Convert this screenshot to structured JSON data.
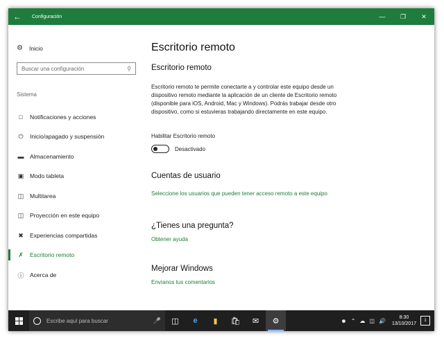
{
  "window": {
    "title": "Configuración",
    "back_icon": "arrow-left-icon",
    "accent": "#1e7d3c"
  },
  "sidebar": {
    "home_label": "Inicio",
    "search_placeholder": "Buscar una configuración",
    "section_label": "Sistema",
    "items": [
      {
        "label": "Notificaciones y acciones",
        "icon": "notification-icon"
      },
      {
        "label": "Inicio/apagado y suspensión",
        "icon": "power-icon"
      },
      {
        "label": "Almacenamiento",
        "icon": "storage-icon"
      },
      {
        "label": "Modo tableta",
        "icon": "tablet-icon"
      },
      {
        "label": "Multitarea",
        "icon": "multitask-icon"
      },
      {
        "label": "Proyección en este equipo",
        "icon": "project-icon"
      },
      {
        "label": "Experiencias compartidas",
        "icon": "shared-icon"
      },
      {
        "label": "Escritorio remoto",
        "icon": "remote-icon",
        "active": true
      },
      {
        "label": "Acerca de",
        "icon": "info-icon"
      }
    ]
  },
  "main": {
    "page_title": "Escritorio remoto",
    "section_title": "Escritorio remoto",
    "description": "Escritorio remoto te permite conectarte a y controlar este equipo desde un dispositivo remoto mediante la aplicación de un cliente de Escritorio remoto (disponible para iOS, Android, Mac y Windows). Podrás trabajar desde otro dispositivo, como si estuvieras trabajando directamente en este equipo.",
    "toggle_label": "Habilitar Escritorio remoto",
    "toggle_state": "Desactivado",
    "accounts_title": "Cuentas de usuario",
    "accounts_link": "Seleccione los usuarios que pueden tener acceso remoto a este equipo",
    "question_title": "¿Tienes una pregunta?",
    "help_link": "Obtener ayuda",
    "improve_title": "Mejorar Windows",
    "feedback_link": "Envíanos tus comentarios"
  },
  "taskbar": {
    "search_placeholder": "Escribe aquí para buscar",
    "time": "8:30",
    "date": "13/10/2017",
    "notification_count": "1"
  }
}
